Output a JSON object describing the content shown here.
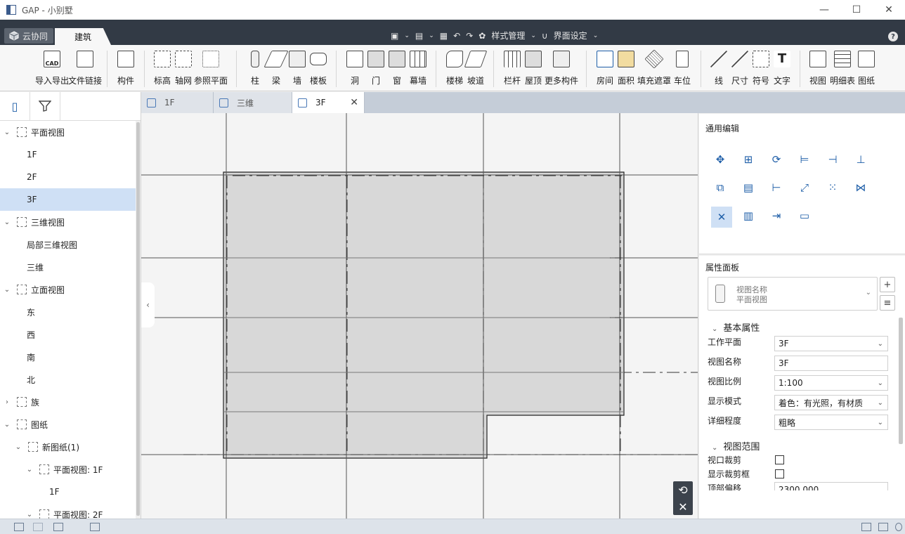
{
  "window": {
    "title": "GAP - 小别墅",
    "controls": [
      "—",
      "☐",
      "✕"
    ]
  },
  "ribbon_tabs": {
    "cloud_label": "云协同",
    "active_tab": "建筑",
    "style_manage": "样式管理",
    "ui_settings": "界面设定",
    "help": "?"
  },
  "toolbar": {
    "import_export": "导入导出",
    "file_link": "文件链接",
    "component": "构件",
    "level": "标高",
    "grid": "轴网",
    "ref_plane": "参照平面",
    "column": "柱",
    "beam": "梁",
    "wall": "墙",
    "floor": "楼板",
    "opening": "洞",
    "door": "门",
    "window": "窗",
    "curtain_wall": "幕墙",
    "stair": "楼梯",
    "ramp": "坡道",
    "railing": "栏杆",
    "roof": "屋顶",
    "more_components": "更多构件",
    "room": "房间",
    "area": "面积",
    "fill_mask": "填充遮罩",
    "parking": "车位",
    "line": "线",
    "dimension": "尺寸",
    "symbol": "符号",
    "text": "文字",
    "view": "视图",
    "schedule": "明细表",
    "sheet": "图纸",
    "cad_badge": "CAD"
  },
  "tree": {
    "items": [
      {
        "label": "平面视图",
        "level": 0,
        "expanded": true
      },
      {
        "label": "1F",
        "level": 1
      },
      {
        "label": "2F",
        "level": 1
      },
      {
        "label": "3F",
        "level": 1,
        "selected": true
      },
      {
        "label": "三维视图",
        "level": 0,
        "expanded": true
      },
      {
        "label": "局部三维视图",
        "level": 1
      },
      {
        "label": "三维",
        "level": 1
      },
      {
        "label": "立面视图",
        "level": 0,
        "expanded": true
      },
      {
        "label": "东",
        "level": 1
      },
      {
        "label": "西",
        "level": 1
      },
      {
        "label": "南",
        "level": 1
      },
      {
        "label": "北",
        "level": 1
      },
      {
        "label": "族",
        "level": 0,
        "expanded": false
      },
      {
        "label": "图纸",
        "level": 0,
        "expanded": true
      },
      {
        "label": "新图纸(1)",
        "level": 1,
        "expanded": true
      },
      {
        "label": "平面视图: 1F",
        "level": 2,
        "expanded": true
      },
      {
        "label": "1F",
        "level": 3
      },
      {
        "label": "平面视图: 2F",
        "level": 2,
        "expanded": true
      }
    ]
  },
  "doc_tabs": [
    {
      "label": "1F",
      "active": false
    },
    {
      "label": "三维",
      "active": false
    },
    {
      "label": "3F",
      "active": true
    }
  ],
  "general_edit": {
    "title": "通用编辑"
  },
  "properties": {
    "title": "属性面板",
    "view_type_name_label": "视图名称",
    "view_type_value": "平面视图",
    "basic_section": "基本属性",
    "work_plane_label": "工作平面",
    "work_plane_value": "3F",
    "view_name_label": "视图名称",
    "view_name_value": "3F",
    "view_scale_label": "视图比例",
    "view_scale_value": "1:100",
    "display_mode_label": "显示模式",
    "display_mode_value": "着色：有光照，有材质",
    "detail_level_label": "详细程度",
    "detail_level_value": "粗略",
    "range_section": "视图范围",
    "crop_view_label": "视口裁剪",
    "crop_view_checked": false,
    "show_crop_label": "显示裁剪框",
    "show_crop_checked": false,
    "top_offset_label": "顶部偏移",
    "top_offset_value": "2300.000"
  },
  "colors": {
    "accent": "#1e5ea8",
    "dark_bar": "#323a45",
    "selection": "#cfe0f5",
    "slab_fill": "#d8d8d8"
  }
}
